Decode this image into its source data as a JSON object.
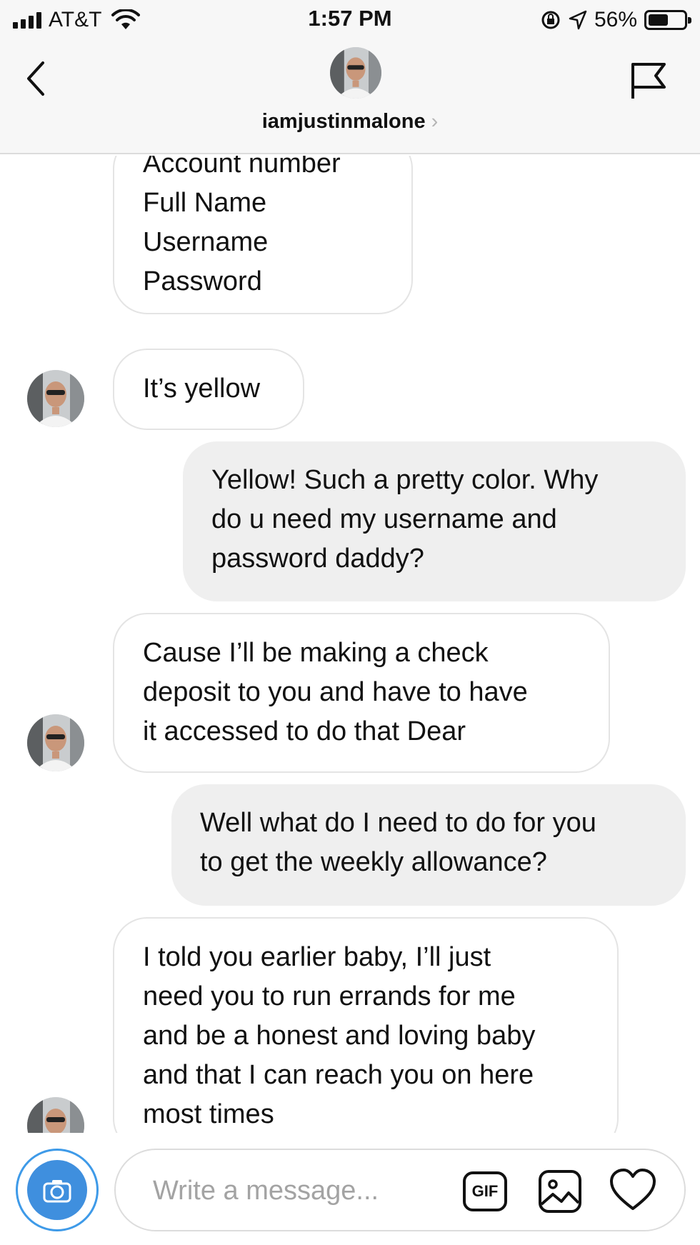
{
  "status_bar": {
    "carrier": "AT&T",
    "time": "1:57 PM",
    "battery_percent": "56%",
    "battery_level": 0.56
  },
  "header": {
    "username": "iamjustinmalone",
    "chevron": "›",
    "back_icon": "chevron-left-icon",
    "flag_icon": "flag-icon"
  },
  "messages": [
    {
      "from": "them",
      "lines": [
        "Account number",
        "Full Name",
        "Username",
        "Password"
      ],
      "avatar": false
    },
    {
      "from": "them",
      "lines": [
        "It’s yellow"
      ],
      "avatar": true
    },
    {
      "from": "me",
      "lines": [
        "Yellow! Such a pretty color. Why",
        "do u need my username and",
        "password daddy?"
      ]
    },
    {
      "from": "them",
      "lines": [
        "Cause I’ll be making a check",
        "deposit to you and have to have",
        "it accessed to do that Dear"
      ],
      "avatar": true
    },
    {
      "from": "me",
      "lines": [
        "Well what do I need to do for you",
        "to get the weekly allowance?"
      ]
    },
    {
      "from": "them",
      "lines": [
        "I told you earlier baby, I’ll just",
        "need you to run errands for me",
        "and be a honest and loving baby",
        "and that I can reach you on here",
        "most times"
      ],
      "avatar": true
    }
  ],
  "composer": {
    "placeholder": "Write a message...",
    "gif_label": "GIF",
    "camera_icon": "camera-icon",
    "photo_icon": "photo-icon",
    "heart_icon": "heart-icon",
    "accent_color": "#3f8fde"
  }
}
